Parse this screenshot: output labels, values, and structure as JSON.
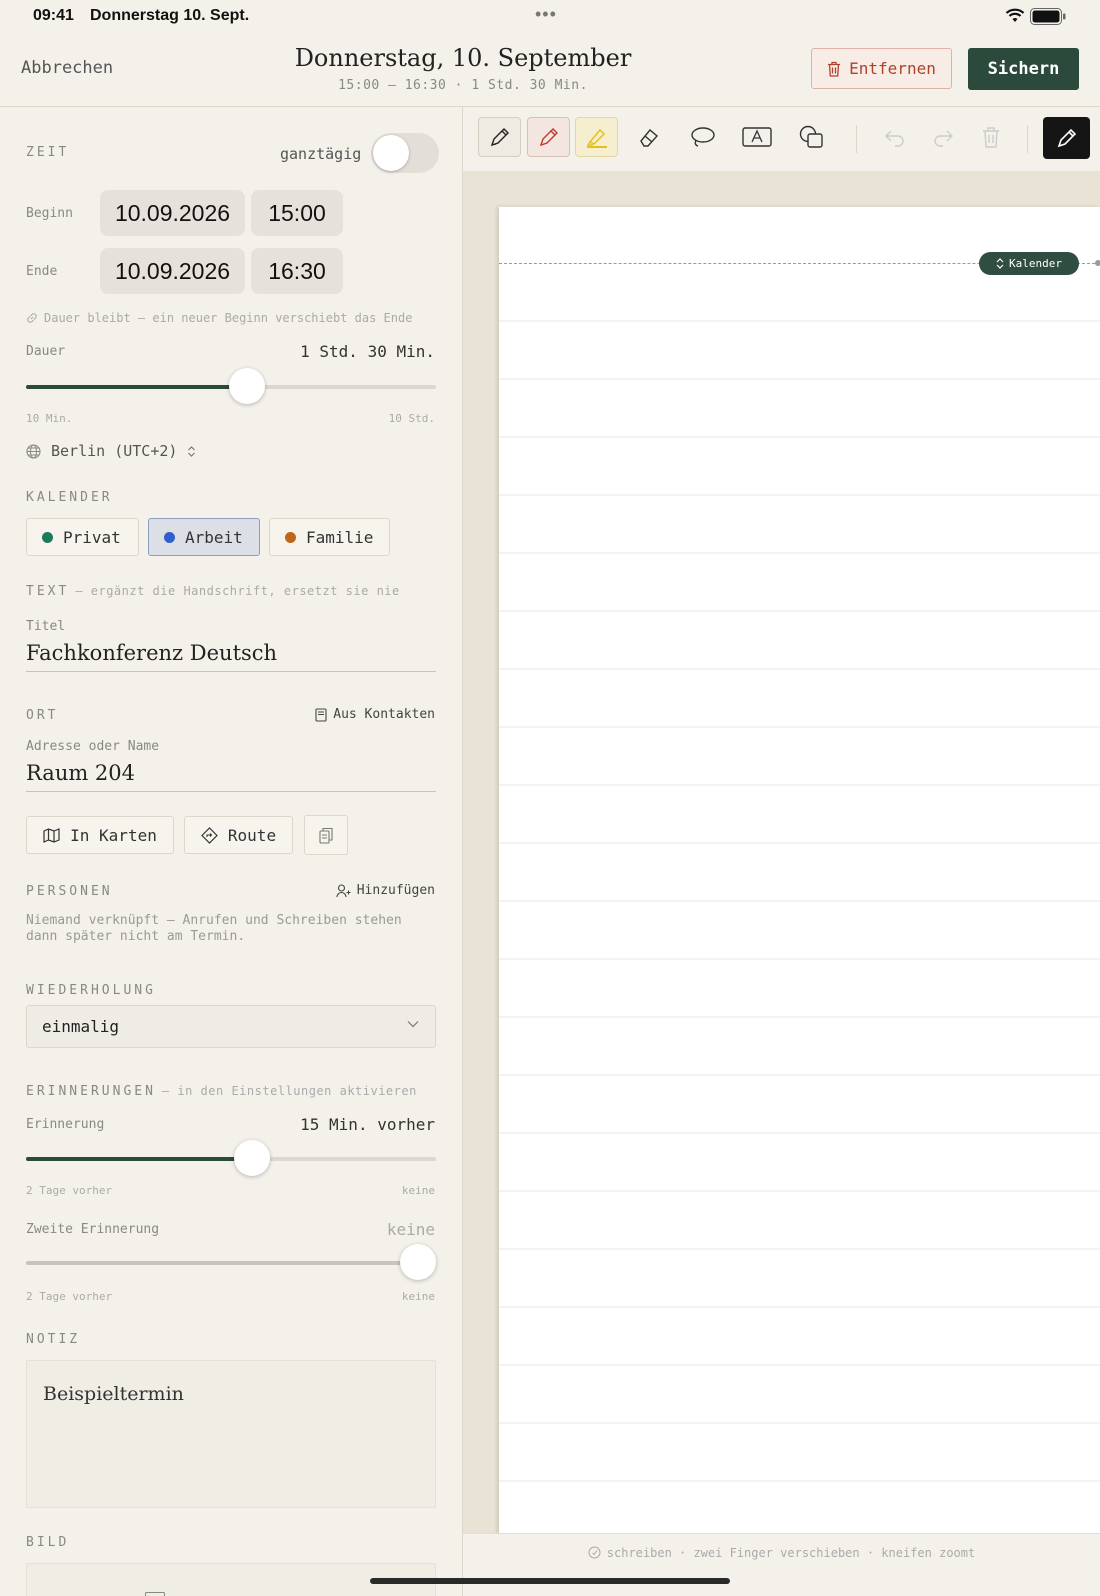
{
  "status": {
    "time": "09:41",
    "date": "Donnerstag 10. Sept."
  },
  "header": {
    "cancel": "Abbrechen",
    "title": "Donnerstag, 10. September",
    "subtitle": "15:00 – 16:30  ·  1 Std. 30 Min.",
    "remove": "Entfernen",
    "save": "Sichern"
  },
  "zeit": {
    "label": "ZEIT",
    "allday_label": "ganztägig",
    "allday": false,
    "start_label": "Beginn",
    "start_date": "10.09.2026",
    "start_time": "15:00",
    "end_label": "Ende",
    "end_date": "10.09.2026",
    "end_time": "16:30",
    "lock_note": "Dauer bleibt – ein neuer Beginn verschiebt das Ende",
    "duration_label": "Dauer",
    "duration_value": "1 Std. 30 Min.",
    "duration_fraction": 0.54,
    "duration_min": "10 Min.",
    "duration_max": "10 Std.",
    "timezone": "Berlin (UTC+2)"
  },
  "kalender": {
    "label": "KALENDER",
    "items": [
      {
        "label": "Privat",
        "color": "#1e7a5c"
      },
      {
        "label": "Arbeit",
        "color": "#2f5fcf"
      },
      {
        "label": "Familie",
        "color": "#c0661a"
      }
    ],
    "selected": "Arbeit"
  },
  "text": {
    "label": "TEXT",
    "note": "– ergänzt die Handschrift, ersetzt sie nie",
    "title_label": "Titel",
    "title_value": "Fachkonferenz Deutsch"
  },
  "ort": {
    "label": "ORT",
    "contacts": "Aus Kontakten",
    "address_label": "Adresse oder Name",
    "address_value": "Raum 204",
    "maps": "In Karten",
    "route": "Route"
  },
  "personen": {
    "label": "PERSONEN",
    "add": "Hinzufügen",
    "info_line1": "Niemand verknüpft – Anrufen und Schreiben stehen",
    "info_line2": "dann später nicht am Termin."
  },
  "wiederholung": {
    "label": "WIEDERHOLUNG",
    "value": "einmalig"
  },
  "erinnerungen": {
    "label": "ERINNERUNGEN",
    "note": "– in den Einstellungen aktivieren",
    "first_label": "Erinnerung",
    "first_value": "15 Min. vorher",
    "first_fraction": 0.55,
    "second_label": "Zweite Erinnerung",
    "second_value": "keine",
    "second_fraction": 1.0,
    "range_min": "2 Tage vorher",
    "range_max": "keine"
  },
  "notiz": {
    "label": "NOTIZ",
    "value": "Beispieltermin"
  },
  "bild": {
    "label": "BILD"
  },
  "canvas": {
    "badge": "Kalender",
    "hint": "schreiben · zwei Finger verschieben · kneifen zoomt"
  }
}
